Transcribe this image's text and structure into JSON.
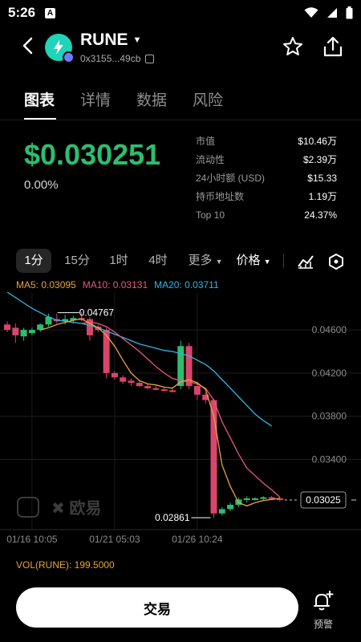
{
  "status": {
    "time": "5:26",
    "app_icon": "A"
  },
  "header": {
    "token_name": "RUNE",
    "address": "0x3155...49cb"
  },
  "tabs": [
    {
      "label": "图表"
    },
    {
      "label": "详情"
    },
    {
      "label": "数据"
    },
    {
      "label": "风险"
    }
  ],
  "price": {
    "value": "$0.030251",
    "change": "0.00%"
  },
  "stats": [
    {
      "label": "市值",
      "value": "$10.46万"
    },
    {
      "label": "流动性",
      "value": "$2.39万"
    },
    {
      "label": "24小时额 (USD)",
      "value": "$15.33"
    },
    {
      "label": "持币地址数",
      "value": "1.19万"
    },
    {
      "label": "Top 10",
      "value": "24.37%"
    }
  ],
  "intervals": {
    "items": [
      "1分",
      "15分",
      "1时",
      "4时"
    ],
    "more": "更多",
    "price": "价格"
  },
  "ma_legend": {
    "ma5": "MA5: 0.03095",
    "ma10": "MA10: 0.03131",
    "ma20": "MA20: 0.03711"
  },
  "colors": {
    "up": "#2dbd6e",
    "down": "#d9456b",
    "ma5": "#e8a33c",
    "ma10": "#e8577f",
    "ma20": "#2fb6e0"
  },
  "chart_data": {
    "type": "candlestick",
    "y_ticks": [
      "0.04600",
      "0.04200",
      "0.03800",
      "0.03400"
    ],
    "y_tick_values": [
      0.046,
      0.042,
      0.038,
      0.034
    ],
    "ylim": [
      0.0275,
      0.0495
    ],
    "x_ticks": [
      "01/16 10:05",
      "01/21 05:03",
      "01/26 10:24"
    ],
    "x_tick_index": [
      3,
      13,
      23
    ],
    "high_label": "0.04767",
    "low_label": "0.02861",
    "current_price_label": "0.03025",
    "current_price": 0.03025,
    "high_value": 0.04767,
    "high_index": 9,
    "low_value": 0.02861,
    "low_index": 25,
    "candles": [
      {
        "o": 0.0465,
        "h": 0.0468,
        "l": 0.0458,
        "c": 0.046
      },
      {
        "o": 0.0462,
        "h": 0.0466,
        "l": 0.0448,
        "c": 0.0455
      },
      {
        "o": 0.0454,
        "h": 0.0462,
        "l": 0.045,
        "c": 0.046
      },
      {
        "o": 0.0457,
        "h": 0.0462,
        "l": 0.0455,
        "c": 0.046
      },
      {
        "o": 0.046,
        "h": 0.0466,
        "l": 0.0458,
        "c": 0.0465
      },
      {
        "o": 0.0465,
        "h": 0.0475,
        "l": 0.0463,
        "c": 0.0472
      },
      {
        "o": 0.047,
        "h": 0.0475,
        "l": 0.0466,
        "c": 0.0468
      },
      {
        "o": 0.0468,
        "h": 0.0474,
        "l": 0.0465,
        "c": 0.047
      },
      {
        "o": 0.0469,
        "h": 0.0473,
        "l": 0.0466,
        "c": 0.0471
      },
      {
        "o": 0.0471,
        "h": 0.04767,
        "l": 0.0468,
        "c": 0.047
      },
      {
        "o": 0.047,
        "h": 0.0472,
        "l": 0.045,
        "c": 0.0455
      },
      {
        "o": 0.0463,
        "h": 0.0465,
        "l": 0.0458,
        "c": 0.046
      },
      {
        "o": 0.046,
        "h": 0.0462,
        "l": 0.0415,
        "c": 0.042
      },
      {
        "o": 0.042,
        "h": 0.0422,
        "l": 0.0414,
        "c": 0.0416
      },
      {
        "o": 0.0416,
        "h": 0.0418,
        "l": 0.041,
        "c": 0.0412
      },
      {
        "o": 0.0413,
        "h": 0.0415,
        "l": 0.0408,
        "c": 0.0411
      },
      {
        "o": 0.0411,
        "h": 0.0413,
        "l": 0.0407,
        "c": 0.0408
      },
      {
        "o": 0.0408,
        "h": 0.041,
        "l": 0.0405,
        "c": 0.0406
      },
      {
        "o": 0.0406,
        "h": 0.0408,
        "l": 0.0404,
        "c": 0.0405
      },
      {
        "o": 0.0405,
        "h": 0.0407,
        "l": 0.0403,
        "c": 0.0404
      },
      {
        "o": 0.0404,
        "h": 0.0406,
        "l": 0.0402,
        "c": 0.0403
      },
      {
        "o": 0.0408,
        "h": 0.045,
        "l": 0.0405,
        "c": 0.0445
      },
      {
        "o": 0.0445,
        "h": 0.0448,
        "l": 0.0405,
        "c": 0.0408
      },
      {
        "o": 0.0408,
        "h": 0.0412,
        "l": 0.0395,
        "c": 0.04
      },
      {
        "o": 0.04,
        "h": 0.0402,
        "l": 0.0392,
        "c": 0.0395
      },
      {
        "o": 0.0395,
        "h": 0.0396,
        "l": 0.02861,
        "c": 0.029
      },
      {
        "o": 0.029,
        "h": 0.0296,
        "l": 0.0288,
        "c": 0.0294
      },
      {
        "o": 0.0294,
        "h": 0.03,
        "l": 0.0292,
        "c": 0.0298
      },
      {
        "o": 0.0298,
        "h": 0.0305,
        "l": 0.0296,
        "c": 0.0303
      },
      {
        "o": 0.0303,
        "h": 0.0306,
        "l": 0.03,
        "c": 0.0304
      },
      {
        "o": 0.0304,
        "h": 0.0305,
        "l": 0.0302,
        "c": 0.0304
      },
      {
        "o": 0.0304,
        "h": 0.0306,
        "l": 0.0302,
        "c": 0.0305
      },
      {
        "o": 0.0305,
        "h": 0.0306,
        "l": 0.0303,
        "c": 0.0304
      },
      {
        "o": 0.0304,
        "h": 0.0305,
        "l": 0.0301,
        "c": 0.03025
      }
    ],
    "ma5": [
      null,
      null,
      null,
      null,
      0.046,
      0.0462,
      0.0465,
      0.0467,
      0.0469,
      0.047,
      0.0466,
      0.0462,
      0.0455,
      0.0445,
      0.0432,
      0.042,
      0.0413,
      0.041,
      0.0409,
      0.0407,
      0.0406,
      0.0412,
      0.0414,
      0.0411,
      0.0405,
      0.038,
      0.0335,
      0.0315,
      0.03,
      0.0297,
      0.03,
      0.0302,
      0.0303,
      0.0304
    ],
    "ma10": [
      null,
      null,
      null,
      null,
      null,
      null,
      null,
      null,
      null,
      0.0466,
      0.0467,
      0.0466,
      0.0463,
      0.0458,
      0.0452,
      0.0446,
      0.044,
      0.0433,
      0.0426,
      0.042,
      0.0415,
      0.0413,
      0.0412,
      0.041,
      0.0406,
      0.0395,
      0.0375,
      0.036,
      0.0345,
      0.0332,
      0.0325,
      0.0318,
      0.0312,
      0.0305
    ],
    "ma20": [
      0.0495,
      0.049,
      0.0485,
      0.048,
      0.0476,
      0.0472,
      0.0469,
      0.0468,
      0.0467,
      0.0466,
      0.0464,
      0.0462,
      0.0459,
      0.0456,
      0.0453,
      0.045,
      0.0447,
      0.0445,
      0.0443,
      0.0441,
      0.044,
      0.0438,
      0.0436,
      0.0432,
      0.0428,
      0.0422,
      0.0414,
      0.0406,
      0.0398,
      0.039,
      0.0382,
      0.0376,
      0.0371,
      null
    ]
  },
  "watermark": "欧易",
  "volume": {
    "label": "VOL(RUNE): 199.5000"
  },
  "bottom": {
    "trade": "交易",
    "alert": "预警"
  }
}
